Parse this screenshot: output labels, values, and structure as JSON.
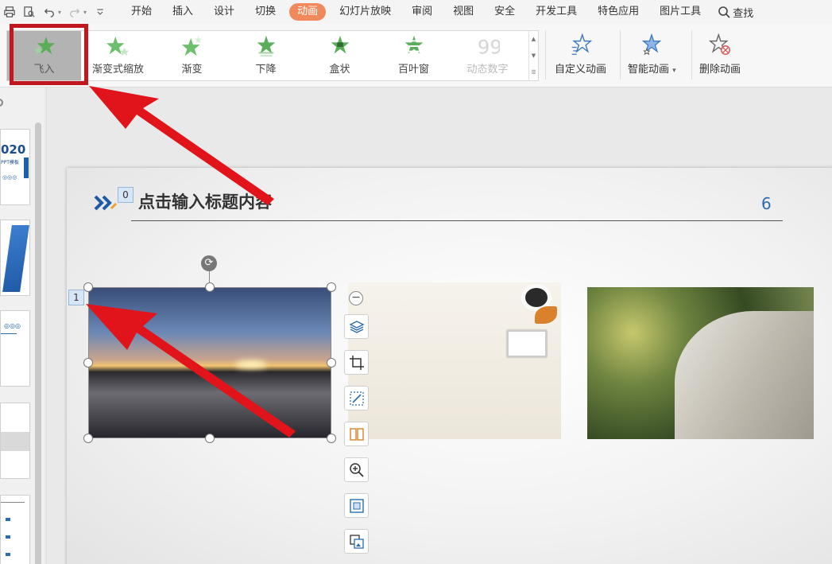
{
  "menubar": {
    "items": [
      "开始",
      "插入",
      "设计",
      "切换",
      "动画",
      "幻灯片放映",
      "审阅",
      "视图",
      "安全",
      "开发工具",
      "特色应用",
      "图片工具"
    ],
    "active_index": 4,
    "search_label": "查找"
  },
  "ribbon": {
    "effects": [
      {
        "label": "飞入",
        "state": "selected"
      },
      {
        "label": "渐变式缩放",
        "state": "normal"
      },
      {
        "label": "渐变",
        "state": "normal"
      },
      {
        "label": "下降",
        "state": "normal"
      },
      {
        "label": "盒状",
        "state": "normal"
      },
      {
        "label": "百叶窗",
        "state": "normal"
      },
      {
        "label": "动态数字",
        "state": "disabled"
      }
    ],
    "custom_animation": "自定义动画",
    "smart_animation": "智能动画",
    "delete_animation": "删除动画"
  },
  "thumbnails": {
    "slide1_big": "020",
    "slide1_small": "PPT模板"
  },
  "slide": {
    "title": "点击输入标题内容",
    "page_number": "6",
    "badge_title": "0",
    "badge_image": "1"
  },
  "colors": {
    "accent": "#f08a5d",
    "highlight_box": "#c0181e",
    "arrow": "#e0141a",
    "page_number": "#2b6cb0"
  }
}
